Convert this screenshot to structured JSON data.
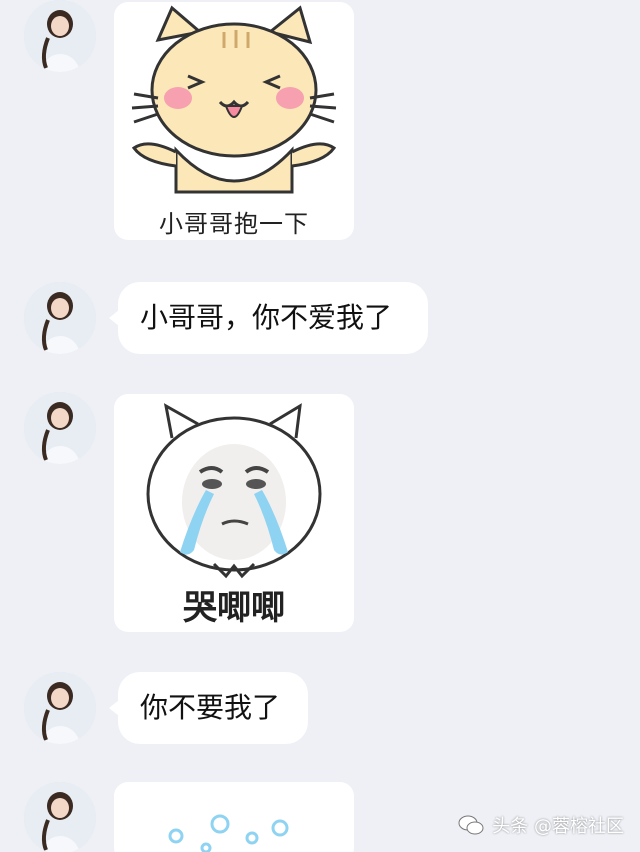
{
  "messages": [
    {
      "type": "sticker",
      "caption": "小哥哥抱一下",
      "sticker_icon": "hugging-cat-sticker"
    },
    {
      "type": "text",
      "text": "小哥哥，你不爱我了"
    },
    {
      "type": "sticker",
      "caption": "哭唧唧",
      "sticker_icon": "crying-cat-face-sticker"
    },
    {
      "type": "text",
      "text": "你不要我了"
    },
    {
      "type": "sticker",
      "caption": "",
      "sticker_icon": "bubbles-sticker"
    }
  ],
  "watermark": {
    "text": "头条 @蓉榕社区",
    "icon": "wechat-bubble-icon"
  },
  "colors": {
    "background": "#eef0f5",
    "bubble": "#ffffff",
    "accent_blue": "#8fd3f2"
  }
}
